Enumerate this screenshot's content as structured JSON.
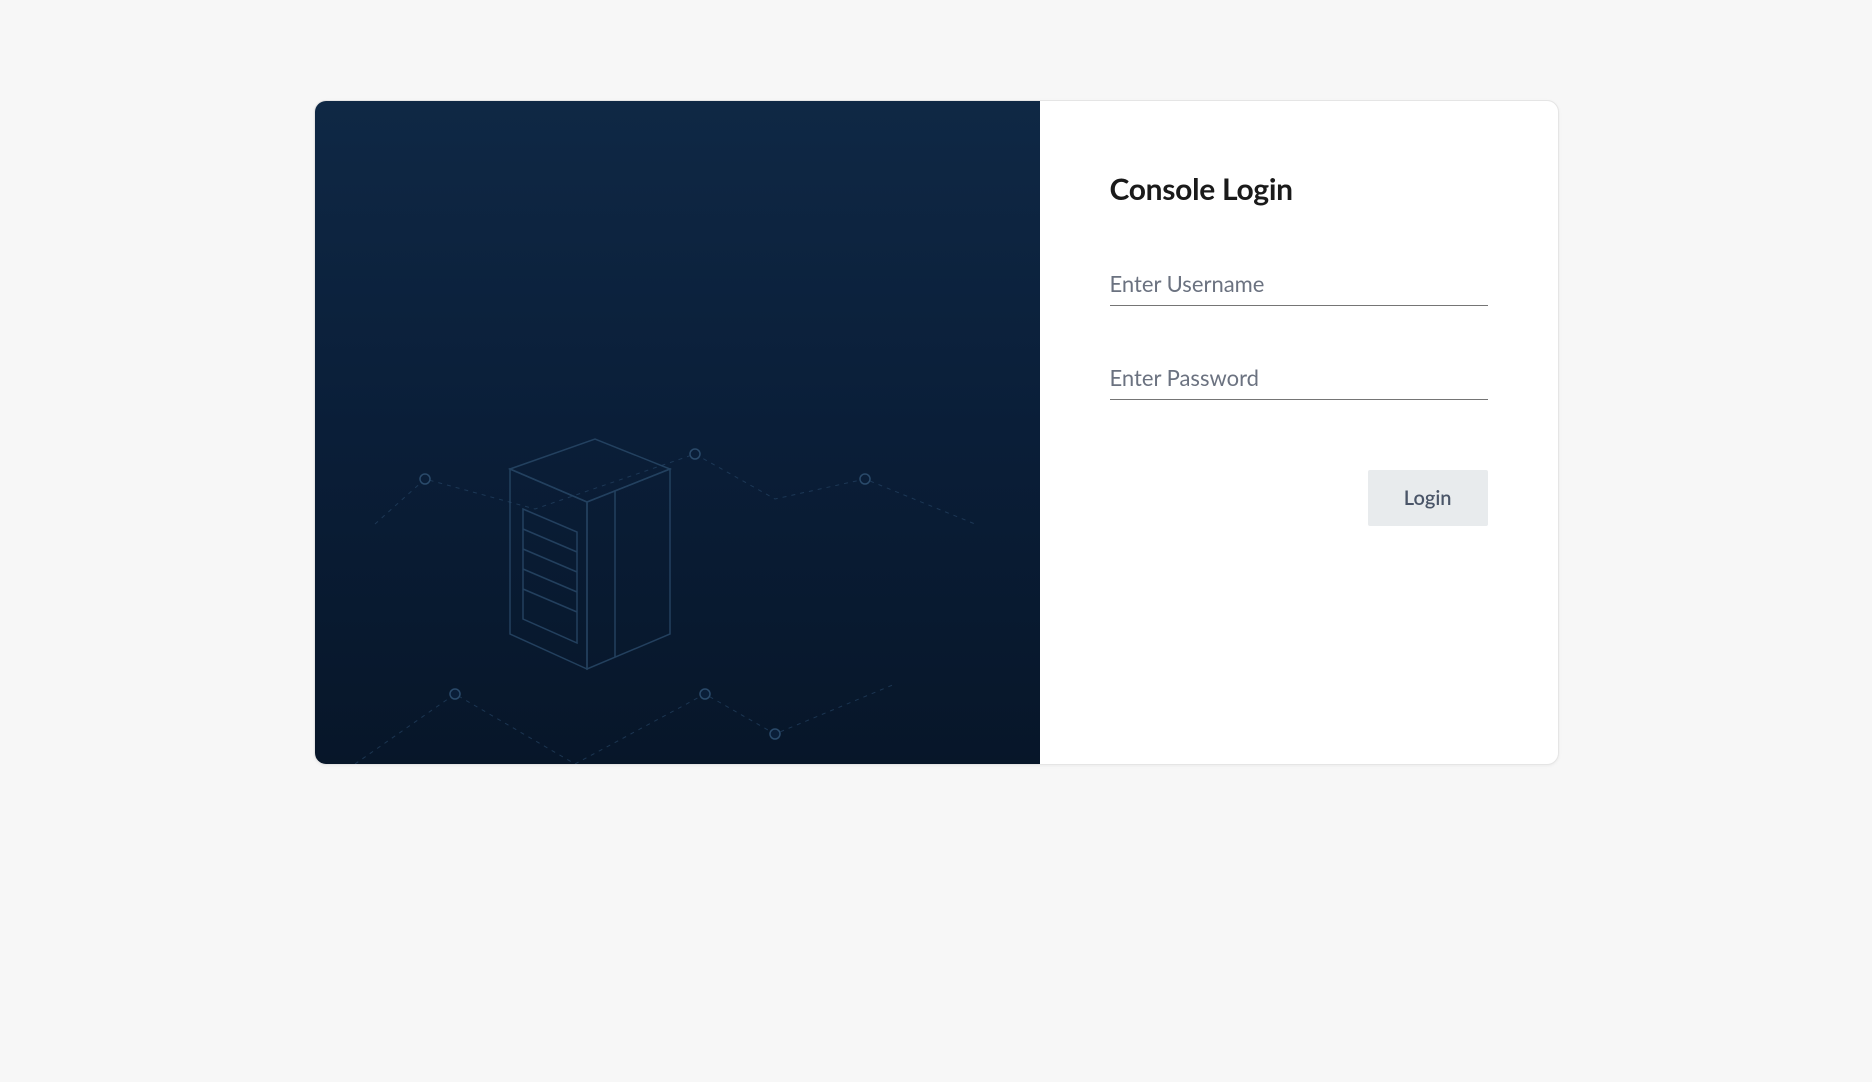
{
  "login": {
    "title": "Console Login",
    "username_placeholder": "Enter Username",
    "username_value": "",
    "password_placeholder": "Enter Password",
    "password_value": "",
    "button_label": "Login"
  }
}
